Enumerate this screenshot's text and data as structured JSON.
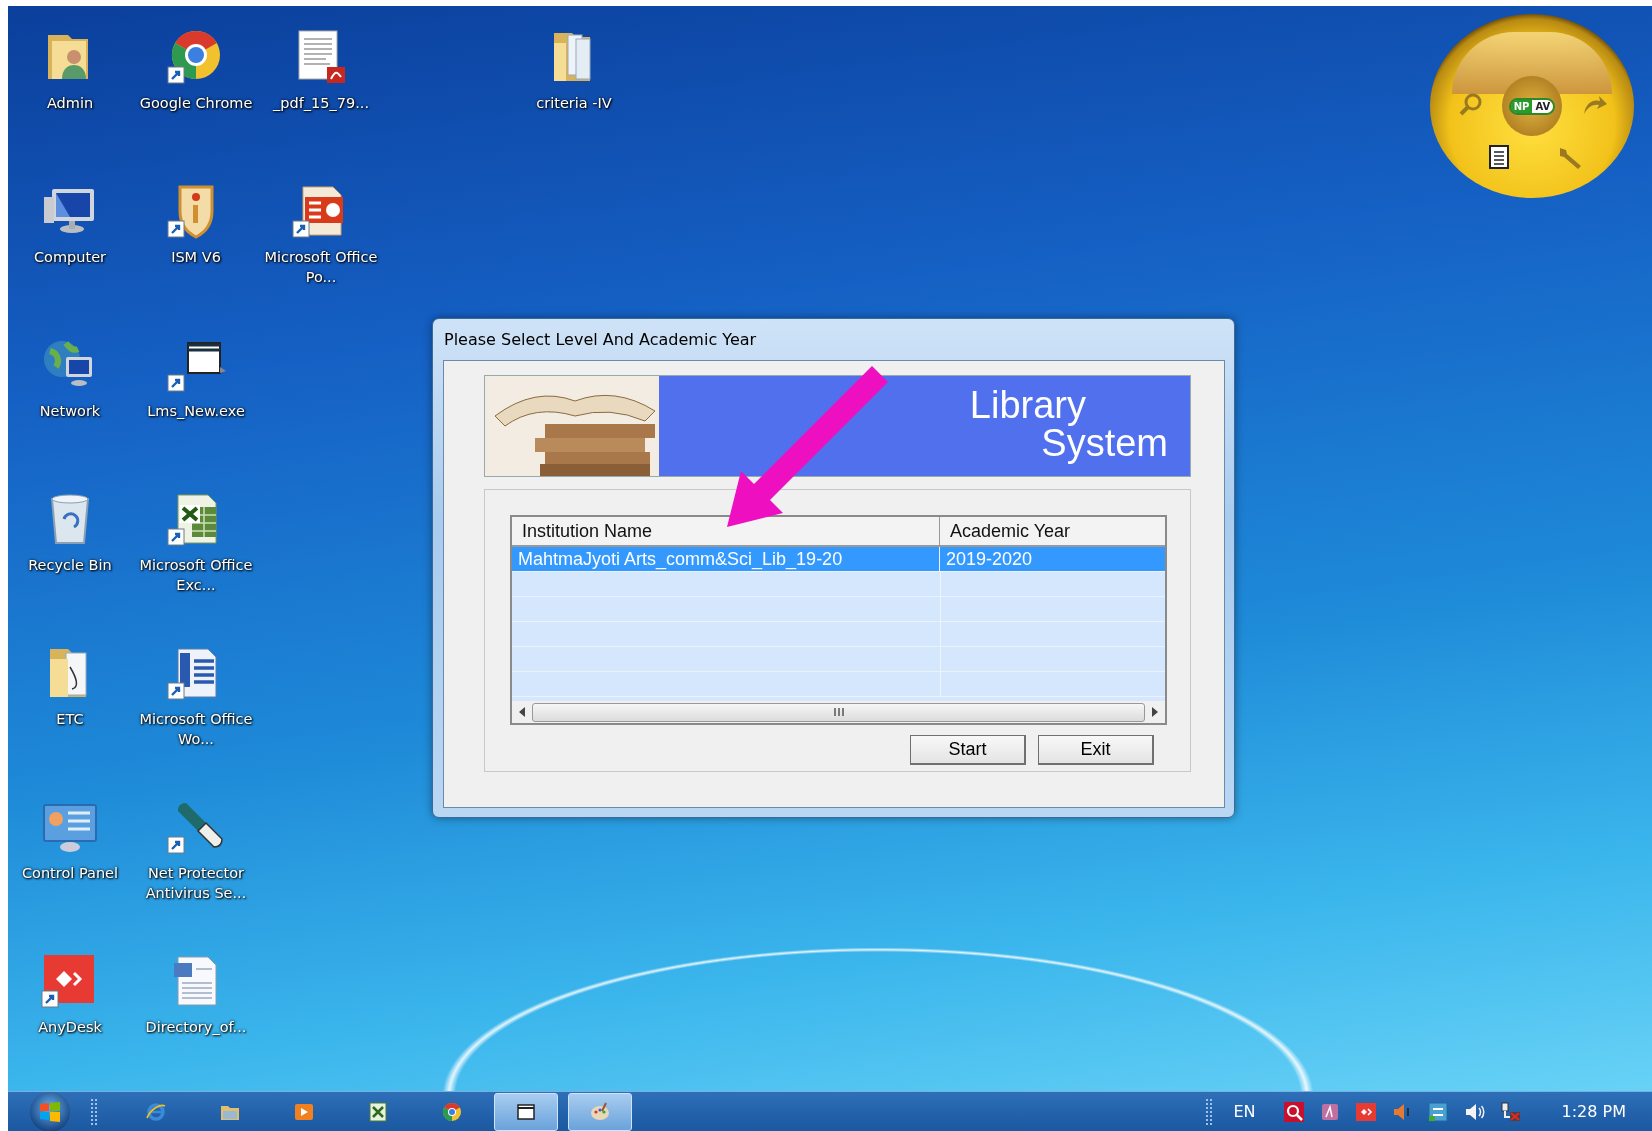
{
  "desktop": {
    "icons": [
      {
        "label": "Admin",
        "kind": "user-folder",
        "shortcut": false
      },
      {
        "label": "Google Chrome",
        "kind": "browser",
        "shortcut": true
      },
      {
        "label": "_pdf_15_79...",
        "kind": "pdf",
        "shortcut": false
      },
      {
        "label": "criteria -IV",
        "kind": "folder-docs",
        "shortcut": false
      },
      {
        "label": "Computer",
        "kind": "computer",
        "shortcut": false
      },
      {
        "label": "ISM V6",
        "kind": "info-shield",
        "shortcut": true
      },
      {
        "label": "Microsoft Office Po...",
        "kind": "presentation",
        "shortcut": true
      },
      {
        "label": "Network",
        "kind": "network",
        "shortcut": false
      },
      {
        "label": "Lms_New.exe",
        "kind": "exe",
        "shortcut": true
      },
      {
        "label": "Recycle Bin",
        "kind": "recycle",
        "shortcut": false
      },
      {
        "label": "Microsoft Office Exc...",
        "kind": "spreadsheet",
        "shortcut": true
      },
      {
        "label": "ETC",
        "kind": "folder",
        "shortcut": false
      },
      {
        "label": "Microsoft Office Wo...",
        "kind": "word",
        "shortcut": true
      },
      {
        "label": "Control Panel",
        "kind": "control-panel",
        "shortcut": false
      },
      {
        "label": "Net Protector Antivirus Se...",
        "kind": "pill",
        "shortcut": true
      },
      {
        "label": "AnyDesk",
        "kind": "remote",
        "shortcut": true
      },
      {
        "label": "Directory_of...",
        "kind": "doc",
        "shortcut": false
      }
    ]
  },
  "gadget": {
    "badge_left": "NP",
    "badge_right": "AV"
  },
  "dialog": {
    "title": "Please Select Level And Academic Year",
    "banner": {
      "line_1": "Library",
      "line_2": "System"
    },
    "table": {
      "columns": [
        "Institution Name",
        "Academic Year"
      ],
      "rows": [
        {
          "cells": [
            "MahtmaJyoti Arts_comm&Sci_Lib_19-20",
            "2019-2020"
          ],
          "selected": true
        }
      ]
    },
    "buttons": [
      "Start",
      "Exit"
    ]
  },
  "taskbar": {
    "pinned": [
      {
        "kind": "ie",
        "active": false
      },
      {
        "kind": "explorer",
        "active": false
      },
      {
        "kind": "media",
        "active": false
      },
      {
        "kind": "spreadsheet",
        "active": false
      },
      {
        "kind": "browser",
        "active": false
      },
      {
        "kind": "window",
        "active": true
      },
      {
        "kind": "paint",
        "active": true
      }
    ],
    "tray": {
      "language": "EN",
      "icons": [
        {
          "kind": "search"
        },
        {
          "kind": "notes"
        },
        {
          "kind": "remote"
        },
        {
          "kind": "speaker-alert"
        },
        {
          "kind": "sync"
        },
        {
          "kind": "volume"
        },
        {
          "kind": "network"
        }
      ],
      "clock": "1:28 PM"
    }
  }
}
